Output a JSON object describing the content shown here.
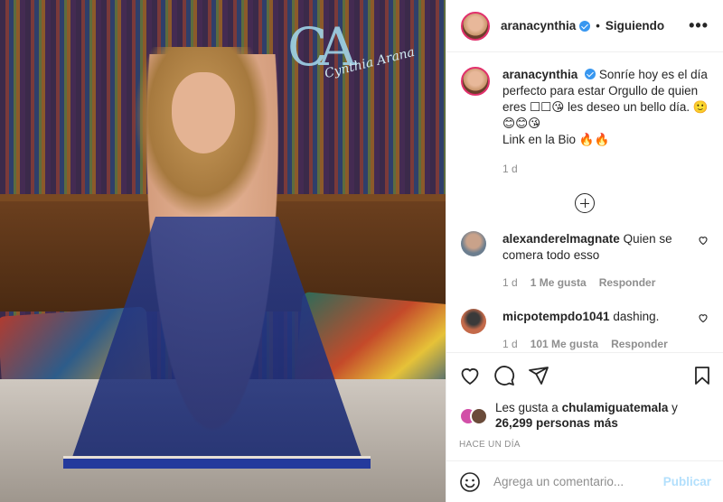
{
  "post": {
    "logo_initials": "CA",
    "logo_signature": "Cynthia Arana"
  },
  "header": {
    "username": "aranacynthia",
    "separator": "•",
    "follow_status": "Siguiendo",
    "more_icon": "more-horizontal-icon",
    "more_glyph": "•••"
  },
  "caption": {
    "username": "aranacynthia",
    "text": "Sonríe hoy es el día perfecto para estar Orgullo de quien eres ☐☐😘 les deseo un bello día. 🙂😊😊😘",
    "link_line": "Link en la Bio 🔥🔥",
    "time": "1 d"
  },
  "comments": [
    {
      "username": "alexanderelmagnate",
      "text": "Quien se comera todo esso",
      "time": "1 d",
      "likes": "1 Me gusta",
      "reply": "Responder"
    },
    {
      "username": "micpotempdo1041",
      "text": "dashing.",
      "time": "1 d",
      "likes": "101 Me gusta",
      "reply": "Responder"
    }
  ],
  "actions": {
    "icons": [
      "heart-icon",
      "comment-icon",
      "share-icon",
      "bookmark-icon"
    ]
  },
  "likes": {
    "prefix": "Les gusta a",
    "user": "chulamiguatemala",
    "connector": "y",
    "count": "26,299 personas más"
  },
  "time_ago": "HACE UN DÍA",
  "add_comment": {
    "emoji_icon": "emoji-icon",
    "placeholder": "Agrega un comentario...",
    "publish": "Publicar"
  },
  "colors": {
    "accent": "#3897f0",
    "publish_disabled": "#b2dffc",
    "muted": "#8e8e8e",
    "text": "#262626",
    "border": "#efefef"
  }
}
